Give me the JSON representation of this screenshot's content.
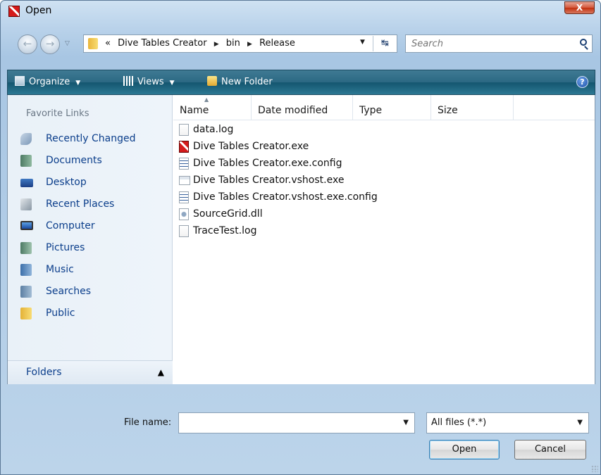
{
  "window": {
    "title": "Open",
    "close_glyph": "X"
  },
  "navigation": {
    "back_glyph": "←",
    "forward_glyph": "→",
    "history_glyph": "▽",
    "breadcrumb_prefix": "«",
    "breadcrumbs": [
      "Dive Tables Creator",
      "bin",
      "Release"
    ],
    "breadcrumb_separator": "▶",
    "address_dropdown_glyph": "▼",
    "refresh_glyph": "↹",
    "search_placeholder": "Search"
  },
  "commandbar": {
    "organize_label": "Organize",
    "views_label": "Views",
    "new_folder_label": "New Folder",
    "dropdown_glyph": "▼",
    "help_glyph": "?"
  },
  "navpane": {
    "favorites_title": "Favorite Links",
    "items": [
      {
        "label": "Recently Changed",
        "icon": "recently-changed-icon"
      },
      {
        "label": "Documents",
        "icon": "documents-icon"
      },
      {
        "label": "Desktop",
        "icon": "desktop-icon"
      },
      {
        "label": "Recent Places",
        "icon": "recent-places-icon"
      },
      {
        "label": "Computer",
        "icon": "computer-icon"
      },
      {
        "label": "Pictures",
        "icon": "pictures-icon"
      },
      {
        "label": "Music",
        "icon": "music-icon"
      },
      {
        "label": "Searches",
        "icon": "searches-icon"
      },
      {
        "label": "Public",
        "icon": "public-folder-icon"
      }
    ],
    "folders_label": "Folders",
    "folders_toggle_glyph": "▲"
  },
  "filelist": {
    "columns": [
      "Name",
      "Date modified",
      "Type",
      "Size"
    ],
    "sort_glyph": "▲",
    "files": [
      {
        "name": "data.log",
        "icon": "log-file-icon"
      },
      {
        "name": "Dive Tables Creator.exe",
        "icon": "exe-app-icon"
      },
      {
        "name": "Dive Tables Creator.exe.config",
        "icon": "config-file-icon"
      },
      {
        "name": "Dive Tables Creator.vshost.exe",
        "icon": "vshost-exe-icon"
      },
      {
        "name": "Dive Tables Creator.vshost.exe.config",
        "icon": "config-file-icon"
      },
      {
        "name": "SourceGrid.dll",
        "icon": "dll-file-icon"
      },
      {
        "name": "TraceTest.log",
        "icon": "log-file-icon"
      }
    ]
  },
  "footer": {
    "filename_label": "File name:",
    "filename_value": "",
    "filename_dropdown_glyph": "▼",
    "filter_value": "All files (*.*)",
    "filter_dropdown_glyph": "▼",
    "open_label": "Open",
    "cancel_label": "Cancel"
  },
  "colors": {
    "commandbar": "#2b6883",
    "link_text": "#0b3e8b",
    "close_button": "#c2300f"
  }
}
